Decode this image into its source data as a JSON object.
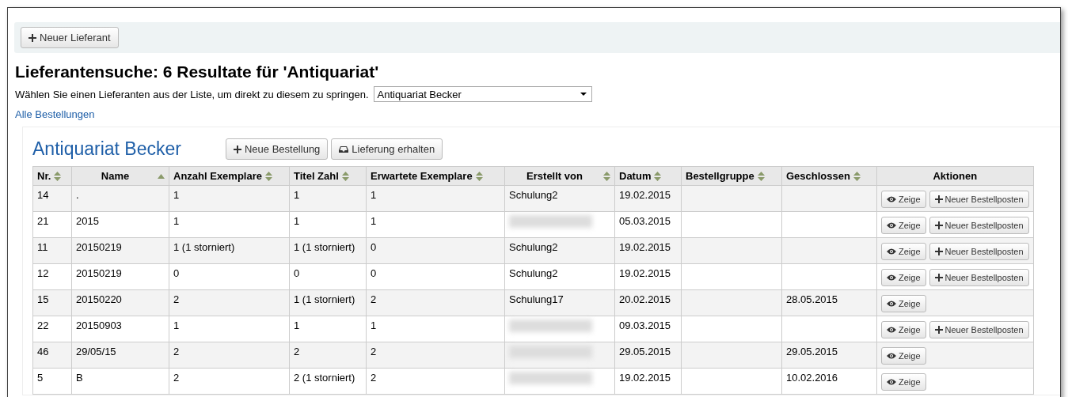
{
  "toolbar": {
    "new_vendor_button": "Neuer Lieferant"
  },
  "heading": "Lieferantensuche: 6 Resultate für 'Antiquariat'",
  "vendor_select": {
    "label": "Wählen Sie einen Lieferanten aus der Liste, um direkt zu diesem zu springen.",
    "value": "Antiquariat Becker"
  },
  "all_orders_link": "Alle Bestellungen",
  "vendor": {
    "name": "Antiquariat Becker",
    "buttons": [
      {
        "kind": "plus",
        "label": "Neue Bestellung"
      },
      {
        "kind": "inbox",
        "label": "Lieferung erhalten"
      }
    ]
  },
  "table": {
    "columns": [
      {
        "label": "Nr.",
        "sortable": true,
        "sorted_ascending": false
      },
      {
        "label": "Name",
        "sortable": true,
        "sorted_ascending": true
      },
      {
        "label": "Anzahl Exemplare",
        "sortable": true,
        "sorted_ascending": false
      },
      {
        "label": "Titel Zahl",
        "sortable": true,
        "sorted_ascending": false
      },
      {
        "label": "Erwartete Exemplare",
        "sortable": true,
        "sorted_ascending": false
      },
      {
        "label": "Erstellt von",
        "sortable": true,
        "sorted_ascending": false
      },
      {
        "label": "Datum",
        "sortable": true,
        "sorted_ascending": false
      },
      {
        "label": "Bestellgruppe",
        "sortable": true,
        "sorted_ascending": false
      },
      {
        "label": "Geschlossen",
        "sortable": true,
        "sorted_ascending": false
      },
      {
        "label": "Aktionen",
        "sortable": false
      }
    ],
    "rows": [
      {
        "nr": "14",
        "name": ".",
        "anzahl": "1",
        "titel": "1",
        "erwartet": "1",
        "erstellt": "Schulung2",
        "redacted": false,
        "datum": "19.02.2015",
        "actions": [
          "Zeige",
          "Neuer Bestellposten"
        ]
      },
      {
        "nr": "21",
        "name": "2015",
        "anzahl": "1",
        "titel": "1",
        "erwartet": "1",
        "redacted": true,
        "datum": "05.03.2015",
        "actions": [
          "Zeige",
          "Neuer Bestellposten"
        ]
      },
      {
        "nr": "11",
        "name": "20150219",
        "anzahl": "1 (1 storniert)",
        "titel": "1 (1 storniert)",
        "erwartet": "0",
        "erstellt": "Schulung2",
        "redacted": false,
        "datum": "19.02.2015",
        "actions": [
          "Zeige",
          "Neuer Bestellposten"
        ]
      },
      {
        "nr": "12",
        "name": "20150219",
        "anzahl": "0",
        "titel": "0",
        "erwartet": "0",
        "erstellt": "Schulung2",
        "redacted": false,
        "datum": "19.02.2015",
        "actions": [
          "Zeige",
          "Neuer Bestellposten"
        ]
      },
      {
        "nr": "15",
        "name": "20150220",
        "anzahl": "2",
        "titel": "1 (1 storniert)",
        "erwartet": "2",
        "erstellt": "Schulung17",
        "redacted": false,
        "datum": "20.02.2015",
        "geschlossen": "28.05.2015",
        "actions": [
          "Zeige"
        ]
      },
      {
        "nr": "22",
        "name": "20150903",
        "anzahl": "1",
        "titel": "1",
        "erwartet": "1",
        "redacted": true,
        "datum": "09.03.2015",
        "actions": [
          "Zeige",
          "Neuer Bestellposten"
        ]
      },
      {
        "nr": "46",
        "name": "29/05/15",
        "anzahl": "2",
        "titel": "2",
        "erwartet": "2",
        "redacted": true,
        "datum": "29.05.2015",
        "geschlossen": "29.05.2015",
        "actions": [
          "Zeige"
        ]
      },
      {
        "nr": "5",
        "name": "B",
        "anzahl": "2",
        "titel": "2 (1 storniert)",
        "erwartet": "2",
        "redacted": true,
        "datum": "19.02.2015",
        "geschlossen": "10.02.2016",
        "actions": [
          "Zeige"
        ]
      }
    ]
  }
}
